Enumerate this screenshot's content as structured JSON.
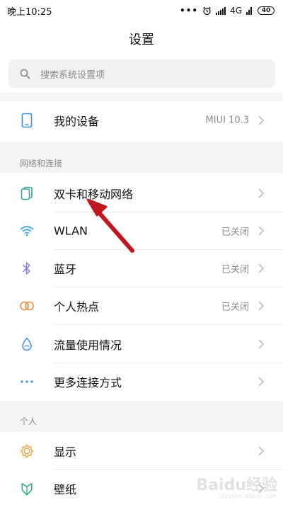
{
  "status_bar": {
    "time": "晚上10:25",
    "dots": "•••",
    "network": "4G",
    "battery": "40"
  },
  "header": {
    "title": "设置"
  },
  "search": {
    "placeholder": "搜索系统设置项"
  },
  "device": {
    "label": "我的设备",
    "value": "MIUI 10.3"
  },
  "sections": {
    "network": {
      "header": "网络和连接",
      "items": [
        {
          "label": "双卡和移动网络",
          "value": ""
        },
        {
          "label": "WLAN",
          "value": "已关闭"
        },
        {
          "label": "蓝牙",
          "value": "已关闭"
        },
        {
          "label": "个人热点",
          "value": "已关闭"
        },
        {
          "label": "流量使用情况",
          "value": ""
        },
        {
          "label": "更多连接方式",
          "value": ""
        }
      ]
    },
    "personal": {
      "header": "个人",
      "items": [
        {
          "label": "显示",
          "value": ""
        },
        {
          "label": "壁纸",
          "value": ""
        }
      ]
    }
  },
  "colors": {
    "device_icon": "#3a8ee6",
    "sim_icon": "#2aa58f",
    "wlan_icon": "#33a9d8",
    "bluetooth_icon": "#8c7be0",
    "hotspot_icon": "#f08a3c",
    "data_usage_icon": "#3a8ee6",
    "more_connections_icon": "#3a8ee6",
    "display_icon": "#f0a030",
    "wallpaper_icon": "#2aa58f",
    "annotation_arrow": "#c0161c"
  },
  "watermark": {
    "text": "Baidu经验",
    "sub": "jingyan.baidu.com"
  }
}
